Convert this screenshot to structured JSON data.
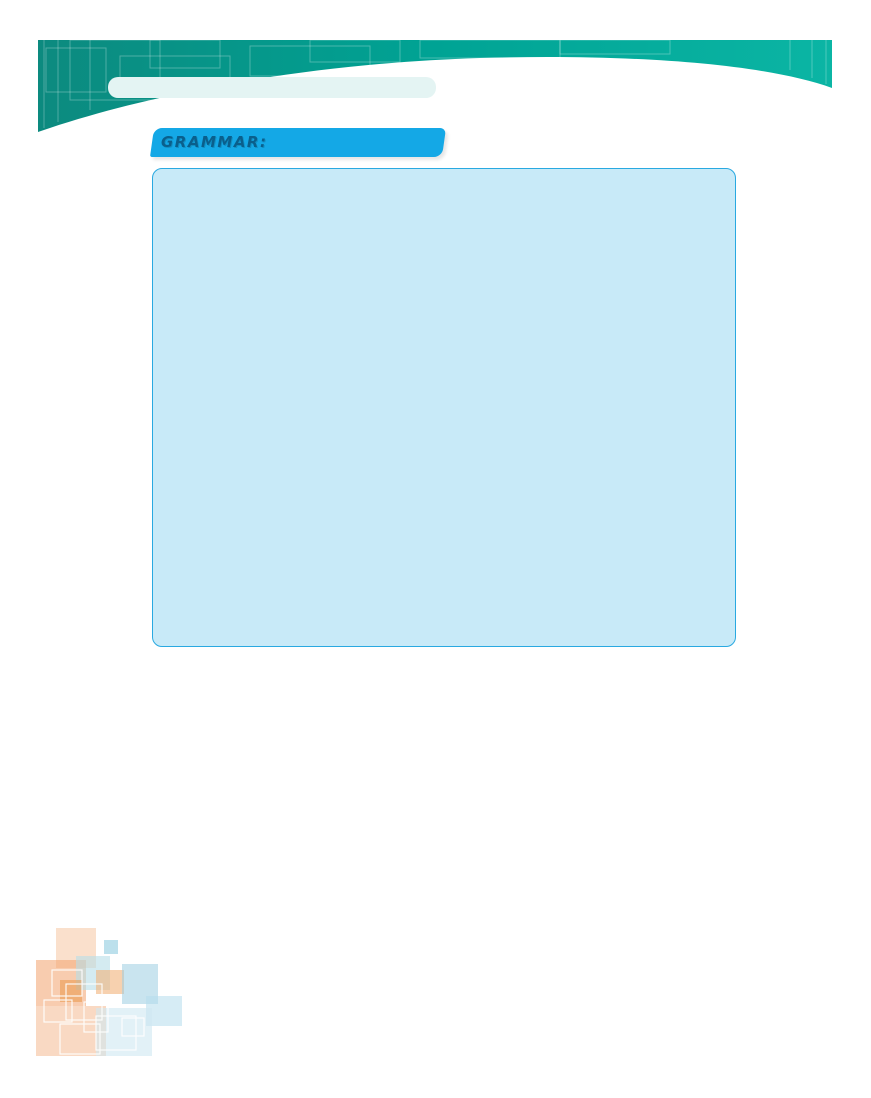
{
  "header": {
    "title": "",
    "band_color": "#009d95"
  },
  "section": {
    "label": "GRAMMAR:",
    "tab_color": "#14a8e6",
    "box_fill": "#c8eaf8",
    "box_border": "#29a9e1"
  },
  "decorations": {
    "corner_pattern": "colored-squares-pattern"
  }
}
